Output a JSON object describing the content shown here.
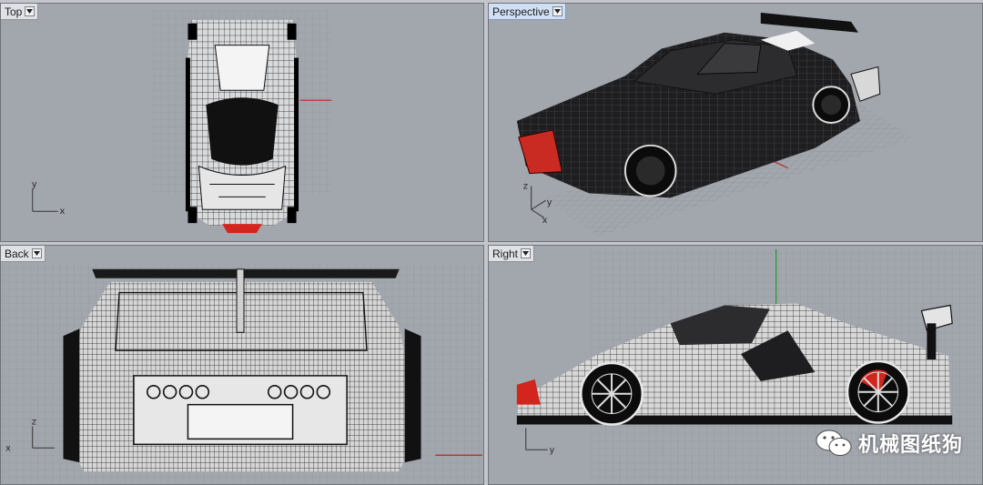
{
  "viewports": {
    "top": {
      "label": "Top"
    },
    "perspective": {
      "label": "Perspective"
    },
    "back": {
      "label": "Back"
    },
    "right": {
      "label": "Right"
    }
  },
  "axes": {
    "x": "x",
    "y": "y",
    "z": "z"
  },
  "watermark": {
    "text": "机械图纸狗"
  },
  "colors": {
    "viewport_bg": "#a2a6ad",
    "grid": "#8c9097",
    "axis_x": "#c4221c",
    "axis_y": "#1c9a2a",
    "active_label": "#cfe0f4"
  },
  "icons": {
    "dropdown": "chevron-down-icon",
    "wechat": "wechat-icon"
  }
}
